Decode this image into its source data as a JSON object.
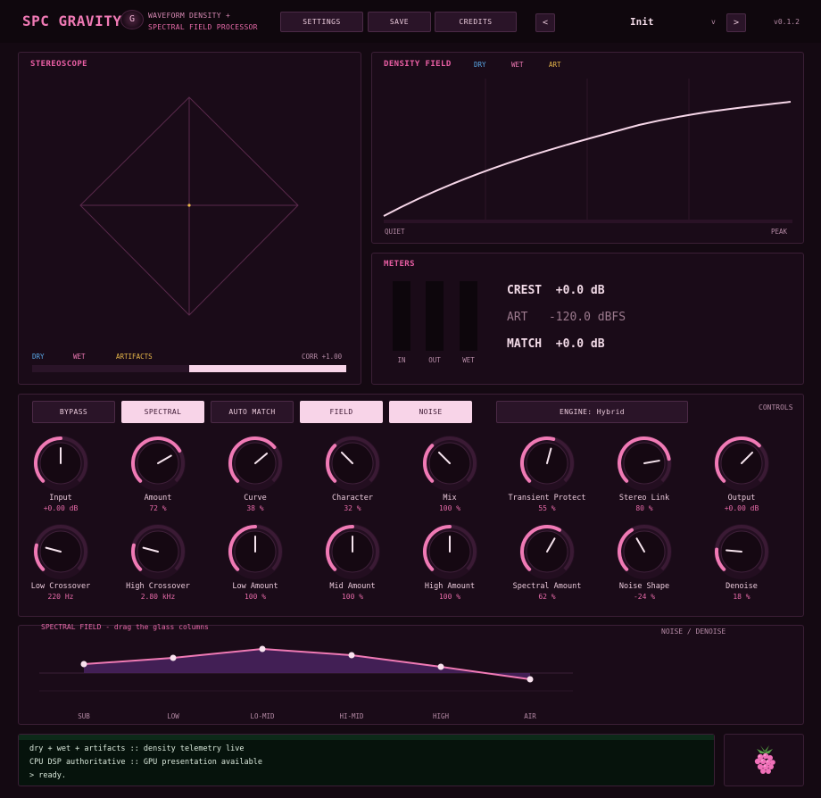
{
  "header": {
    "app_name": "SPC GRAVITY",
    "badge": "G",
    "subtitle_line1": "WAVEFORM DENSITY +",
    "subtitle_line2": "SPECTRAL FIELD PROCESSOR",
    "buttons": {
      "settings": "SETTINGS",
      "save": "SAVE",
      "credits": "CREDITS"
    },
    "prev": "<",
    "next": ">",
    "preset_name": "Init",
    "preset_caret": "v",
    "version": "v0.1.2"
  },
  "stereoscope": {
    "title": "STEREOSCOPE",
    "legend": {
      "dry": "DRY",
      "wet": "WET",
      "artifacts": "ARTIFACTS"
    },
    "correlation": "CORR +1.00",
    "correlation_value": 1.0
  },
  "density_field": {
    "title": "DENSITY FIELD",
    "legend": {
      "dry": "DRY",
      "wet": "WET",
      "art": "ART"
    },
    "axis_left": "QUIET",
    "axis_right": "PEAK"
  },
  "meters": {
    "title": "METERS",
    "labels": [
      "IN",
      "OUT",
      "WET"
    ],
    "crest_label": "CREST",
    "crest_value": "+0.0 dB",
    "art_label": "ART",
    "art_value": "-120.0 dBFS",
    "match_label": "MATCH",
    "match_value": "+0.0 dB"
  },
  "controls": {
    "title": "CONTROLS",
    "toggles": {
      "bypass": "BYPASS",
      "spectral": "SPECTRAL",
      "auto_match": "AUTO MATCH",
      "field": "FIELD",
      "noise": "NOISE"
    },
    "engine": "ENGINE:  Hybrid",
    "knobs_row1": [
      {
        "label": "Input",
        "value": "+0.00 dB"
      },
      {
        "label": "Amount",
        "value": "72 %"
      },
      {
        "label": "Curve",
        "value": "38 %"
      },
      {
        "label": "Character",
        "value": "32 %"
      },
      {
        "label": "Mix",
        "value": "100 %"
      },
      {
        "label": "Transient Protect",
        "value": "55 %"
      },
      {
        "label": "Stereo Link",
        "value": "80 %"
      },
      {
        "label": "Output",
        "value": "+0.00 dB"
      }
    ],
    "knobs_row2": [
      {
        "label": "Low Crossover",
        "value": "220 Hz"
      },
      {
        "label": "High Crossover",
        "value": "2.80 kHz"
      },
      {
        "label": "Low Amount",
        "value": "100 %"
      },
      {
        "label": "Mid Amount",
        "value": "100 %"
      },
      {
        "label": "High Amount",
        "value": "100 %"
      },
      {
        "label": "Spectral Amount",
        "value": "62 %"
      },
      {
        "label": "Noise Shape",
        "value": "-24 %"
      },
      {
        "label": "Denoise",
        "value": "18 %"
      }
    ]
  },
  "spectral_field": {
    "title": "SPECTRAL FIELD - drag the glass columns",
    "bands": [
      "SUB",
      "LOW",
      "LO-MID",
      "HI-MID",
      "HIGH",
      "AIR"
    ]
  },
  "noise_denoise": {
    "title": "NOISE / DENOISE",
    "knobs": [
      {
        "label": "Noise Shape",
        "value": "-24 %"
      },
      {
        "label": "Denoise",
        "value": "18 %"
      }
    ]
  },
  "console": {
    "lines": [
      "dry + wet + artifacts :: density telemetry live",
      "CPU DSP authoritative :: GPU presentation available",
      "> ready."
    ]
  },
  "colors": {
    "accent": "#f07ab5",
    "dry": "#5aa8e8",
    "wet": "#f07ab5",
    "artifacts": "#e8b84a",
    "panel": "#1a0b18"
  }
}
